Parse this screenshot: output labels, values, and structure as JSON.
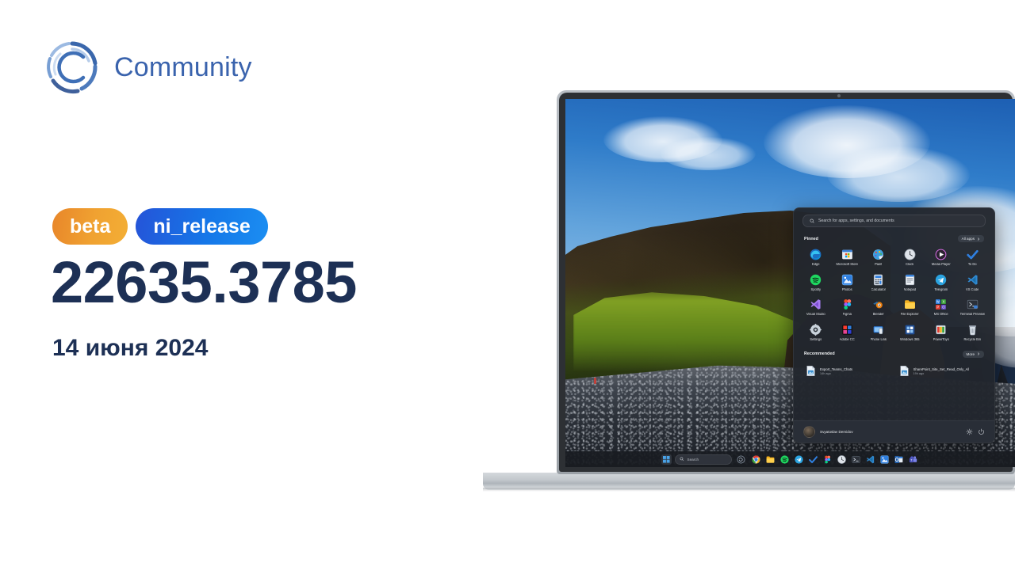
{
  "brand": {
    "name": "Community",
    "logo_icon": "community-circle-logo",
    "color": "#3a63ad"
  },
  "release": {
    "channel_badge": "beta",
    "branch_badge": "ni_release",
    "build_number": "22635.3785",
    "date": "14 июня 2024",
    "badge_colors": {
      "beta": "#f0a231",
      "branch": "#1577e8",
      "text": "#1d3055"
    }
  },
  "device": {
    "type": "laptop",
    "webcam_icon": "webcam-dot"
  },
  "desktop": {
    "wallpaper": "iceland-cliff-black-sand-beach",
    "start_menu": {
      "search": {
        "placeholder": "Search for apps, settings, and documents",
        "icon": "search-icon"
      },
      "pinned": {
        "title": "Pinned",
        "all_apps_label": "All apps",
        "all_apps_icon": "chevron-right-icon",
        "apps": [
          {
            "label": "Edge",
            "icon": "edge-icon"
          },
          {
            "label": "Microsoft Store",
            "icon": "microsoft-store-icon"
          },
          {
            "label": "Paint",
            "icon": "paint-icon"
          },
          {
            "label": "Clock",
            "icon": "clock-icon"
          },
          {
            "label": "Media Player",
            "icon": "media-player-icon"
          },
          {
            "label": "To Do",
            "icon": "to-do-icon"
          },
          {
            "label": "Spotify",
            "icon": "spotify-icon"
          },
          {
            "label": "Photos",
            "icon": "photos-icon"
          },
          {
            "label": "Calculator",
            "icon": "calculator-icon"
          },
          {
            "label": "Notepad",
            "icon": "notepad-icon"
          },
          {
            "label": "Telegram",
            "icon": "telegram-icon"
          },
          {
            "label": "VS Code",
            "icon": "vs-code-icon"
          },
          {
            "label": "Visual Studio",
            "icon": "visual-studio-icon"
          },
          {
            "label": "Figma",
            "icon": "figma-icon"
          },
          {
            "label": "Blender",
            "icon": "blender-icon"
          },
          {
            "label": "File Explorer",
            "icon": "file-explorer-icon"
          },
          {
            "label": "MS Office",
            "icon": "ms-office-icon"
          },
          {
            "label": "Terminal Preview",
            "icon": "terminal-preview-icon"
          },
          {
            "label": "Settings",
            "icon": "settings-icon"
          },
          {
            "label": "Adobe CC",
            "icon": "adobe-cc-icon"
          },
          {
            "label": "Phone Link",
            "icon": "phone-link-icon"
          },
          {
            "label": "Windows 365",
            "icon": "windows-365-icon"
          },
          {
            "label": "PowerToys",
            "icon": "powertoys-icon"
          },
          {
            "label": "Recycle Bin",
            "icon": "recycle-bin-icon"
          }
        ]
      },
      "recommended": {
        "title": "Recommended",
        "more_label": "More",
        "more_icon": "chevron-right-icon",
        "items": [
          {
            "name": "Export_Teams_Chats",
            "time": "14h ago",
            "icon": "document-icon"
          },
          {
            "name": "SharePoint_Site_Set_Read_Only_All",
            "time": "19h ago",
            "icon": "document-icon"
          }
        ]
      },
      "footer": {
        "user_name": "Svyatoslav Demidov",
        "avatar_icon": "avatar",
        "settings_icon": "settings-gear-icon",
        "power_icon": "power-icon"
      }
    },
    "taskbar": {
      "start_icon": "windows-start-icon",
      "search_placeholder": "Search",
      "search_icon": "search-icon",
      "copilot_icon": "copilot-icon",
      "items": [
        {
          "icon": "chrome-icon",
          "label": "Chrome"
        },
        {
          "icon": "file-explorer-icon",
          "label": "File Explorer"
        },
        {
          "icon": "spotify-icon",
          "label": "Spotify"
        },
        {
          "icon": "telegram-icon",
          "label": "Telegram"
        },
        {
          "icon": "to-do-icon",
          "label": "To Do"
        },
        {
          "icon": "figma-icon",
          "label": "Figma"
        },
        {
          "icon": "clock-icon",
          "label": "Clock"
        },
        {
          "icon": "terminal-icon",
          "label": "Terminal"
        },
        {
          "icon": "vs-code-icon",
          "label": "VS Code"
        },
        {
          "icon": "photos-icon",
          "label": "Photos"
        },
        {
          "icon": "outlook-icon",
          "label": "Outlook"
        },
        {
          "icon": "teams-icon",
          "label": "Teams"
        }
      ]
    }
  }
}
